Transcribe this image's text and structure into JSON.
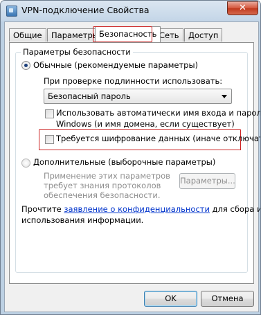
{
  "window": {
    "title": "VPN-подключение Свойства",
    "close_glyph": "✕"
  },
  "tabs": [
    {
      "label": "Общие"
    },
    {
      "label": "Параметры"
    },
    {
      "label": "Безопасность"
    },
    {
      "label": "Сеть"
    },
    {
      "label": "Доступ"
    }
  ],
  "security": {
    "group_title": "Параметры безопасности",
    "typical": {
      "label": "Обычные (рекомендуемые параметры)",
      "checked": true,
      "verify_label": "При проверке подлинности использовать:",
      "verify_value": "Безопасный пароль",
      "auto_logon_line1": "Использовать автоматически имя входа и пароль",
      "auto_logon_line2": "Windows (и имя домена, если существует)",
      "encryption_label": "Требуется шифрование данных (иначе отключаться)"
    },
    "advanced": {
      "label": "Дополнительные (выборочные параметры)",
      "checked": false,
      "description_line1": "Применение этих параметров",
      "description_line2": "требует знания протоколов",
      "description_line3": "обеспечения безопасности.",
      "settings_button": "Параметры..."
    },
    "privacy": {
      "prefix": "Прочтите ",
      "link": "заявление о конфиденциальности",
      "suffix": " для сбора и",
      "line2": "использования информации."
    }
  },
  "buttons": {
    "ok": "OK",
    "cancel": "Отмена"
  },
  "colors": {
    "highlight": "#cc2222",
    "link": "#0033cc"
  }
}
